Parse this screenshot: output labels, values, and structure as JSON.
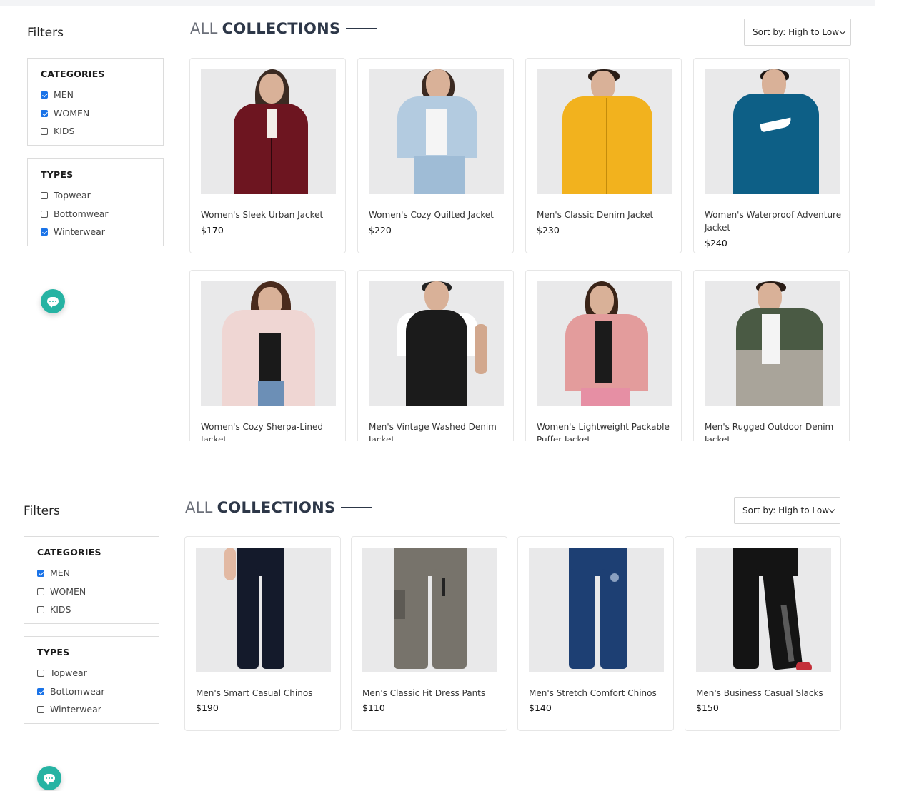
{
  "panels": [
    {
      "filters_title": "Filters",
      "categories": {
        "title": "CATEGORIES",
        "options": [
          {
            "label": "MEN",
            "checked": true
          },
          {
            "label": "WOMEN",
            "checked": true
          },
          {
            "label": "KIDS",
            "checked": false
          }
        ]
      },
      "types": {
        "title": "TYPES",
        "options": [
          {
            "label": "Topwear",
            "checked": false
          },
          {
            "label": "Bottomwear",
            "checked": false
          },
          {
            "label": "Winterwear",
            "checked": true
          }
        ]
      },
      "heading": {
        "light": "ALL",
        "bold": "COLLECTIONS"
      },
      "sort_label": "Sort by: High to Low",
      "products": [
        {
          "name": "Women's Sleek Urban Jacket",
          "price": "$170",
          "garment": "maroon-jacket"
        },
        {
          "name": "Women's Cozy Quilted Jacket",
          "price": "$220",
          "garment": "denim-jacket"
        },
        {
          "name": "Men's Classic Denim Jacket",
          "price": "$230",
          "garment": "yellow-puffer"
        },
        {
          "name": "Women's Waterproof Adventure Jacket",
          "price": "$240",
          "garment": "teal-track-jacket"
        },
        {
          "name": "Women's Cozy Sherpa-Lined Jacket",
          "price": "",
          "garment": "pink-puffer"
        },
        {
          "name": "Men's Vintage Washed Denim Jacket",
          "price": "",
          "garment": "black-vest"
        },
        {
          "name": "Women's Lightweight Packable Puffer Jacket",
          "price": "",
          "garment": "pink-jacket"
        },
        {
          "name": "Men's Rugged Outdoor Denim Jacket",
          "price": "",
          "garment": "olive-puffer"
        }
      ]
    },
    {
      "filters_title": "Filters",
      "categories": {
        "title": "CATEGORIES",
        "options": [
          {
            "label": "MEN",
            "checked": true
          },
          {
            "label": "WOMEN",
            "checked": false
          },
          {
            "label": "KIDS",
            "checked": false
          }
        ]
      },
      "types": {
        "title": "TYPES",
        "options": [
          {
            "label": "Topwear",
            "checked": false
          },
          {
            "label": "Bottomwear",
            "checked": true
          },
          {
            "label": "Winterwear",
            "checked": false
          }
        ]
      },
      "heading": {
        "light": "ALL",
        "bold": "COLLECTIONS"
      },
      "sort_label": "Sort by: High to Low",
      "products": [
        {
          "name": "Men's Smart Casual Chinos",
          "price": "$190",
          "garment": "navy-chinos"
        },
        {
          "name": "Men's Classic Fit Dress Pants",
          "price": "$110",
          "garment": "grey-cargo"
        },
        {
          "name": "Men's Stretch Comfort Chinos",
          "price": "$140",
          "garment": "blue-joggers"
        },
        {
          "name": "Men's Business Casual Slacks",
          "price": "$150",
          "garment": "black-track-pants"
        }
      ]
    }
  ]
}
